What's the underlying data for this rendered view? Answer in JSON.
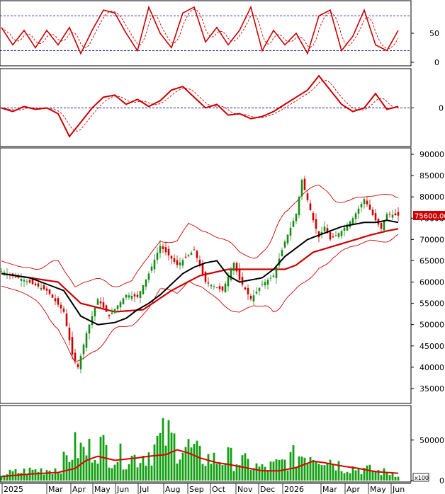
{
  "colors": {
    "background": "#ffffff",
    "frame": "#000000",
    "indicator_line": "#cc0000",
    "reference_dashed": "#1a1aa0",
    "bollinger": "#cc0000",
    "ma_long": "#cc0000",
    "ma_short": "#000000",
    "candle_up": "#1a8a1a",
    "candle_down": "#cc0000",
    "volume_bar": "#12a012",
    "volume_ma": "#dd0000",
    "price_tag_bg": "#cc0000",
    "price_tag_text": "#ffffff"
  },
  "x_axis": {
    "month_labels": [
      "2025",
      "Mar",
      "Apr",
      "May",
      "Jun",
      "Jul",
      "Aug",
      "Sep",
      "Oct",
      "Nov",
      "Dec",
      "2026",
      "Mar",
      "Apr",
      "May",
      "Jun"
    ]
  },
  "price_tag": "75600.00",
  "volume_unit": "x100",
  "chart_data": [
    {
      "type": "line",
      "panel": "oscillator",
      "ylim": [
        0,
        100
      ],
      "y_ticks": [
        "50",
        "0"
      ],
      "reference_lines": [
        80,
        20
      ],
      "x_index": [
        0,
        4,
        8,
        12,
        16,
        20,
        24,
        28,
        32,
        36,
        40,
        44,
        48,
        52,
        56,
        60,
        64,
        68,
        72,
        76,
        80,
        84,
        88,
        92,
        96,
        100,
        104,
        108,
        112,
        116,
        120,
        124,
        128,
        132,
        136,
        140
      ],
      "series": [
        {
          "values": [
            60,
            30,
            55,
            25,
            55,
            30,
            60,
            15,
            55,
            90,
            85,
            50,
            20,
            95,
            50,
            25,
            85,
            95,
            35,
            60,
            30,
            55,
            95,
            20,
            55,
            30,
            50,
            15,
            80,
            90,
            20,
            45,
            90,
            30,
            20,
            55
          ]
        }
      ]
    },
    {
      "type": "line",
      "panel": "momentum",
      "ylim": [
        -50,
        50
      ],
      "y_ticks": [
        "0"
      ],
      "reference_lines": [
        0
      ],
      "x_index": [
        0,
        4,
        8,
        12,
        16,
        20,
        24,
        28,
        32,
        36,
        40,
        44,
        48,
        52,
        56,
        60,
        64,
        68,
        72,
        76,
        80,
        84,
        88,
        92,
        96,
        100,
        104,
        108,
        112,
        116,
        120,
        124,
        128,
        132,
        136,
        140
      ],
      "series": [
        {
          "values": [
            0,
            -5,
            2,
            -2,
            0,
            -8,
            -40,
            -20,
            0,
            15,
            18,
            5,
            12,
            2,
            10,
            25,
            30,
            15,
            0,
            5,
            -10,
            -8,
            -15,
            -12,
            -5,
            5,
            15,
            25,
            45,
            25,
            5,
            -5,
            0,
            20,
            -2,
            2
          ]
        }
      ]
    },
    {
      "type": "candlestick",
      "panel": "price",
      "ylim": [
        32000,
        91000
      ],
      "y_ticks": [
        "90000",
        "85000",
        "80000",
        "75000",
        "70000",
        "65000",
        "60000",
        "55000",
        "50000",
        "45000",
        "40000",
        "35000"
      ],
      "close_anchors_index": [
        0,
        8,
        16,
        22,
        25,
        27,
        30,
        34,
        38,
        44,
        48,
        52,
        56,
        62,
        68,
        72,
        78,
        82,
        84,
        88,
        92,
        96,
        100,
        104,
        106,
        110,
        112,
        114,
        116,
        120,
        124,
        128,
        132,
        134,
        136,
        140
      ],
      "close_anchors": [
        62500,
        60500,
        58000,
        53000,
        43000,
        40000,
        48000,
        56000,
        52000,
        57000,
        56500,
        62000,
        68500,
        64000,
        67500,
        60000,
        58000,
        64500,
        60500,
        56000,
        59500,
        61500,
        69500,
        76000,
        84000,
        74500,
        70500,
        73000,
        70000,
        72000,
        75000,
        79500,
        74500,
        72500,
        76000,
        75600
      ],
      "bollinger_mid_index": [
        0,
        10,
        20,
        26,
        32,
        40,
        46,
        52,
        56,
        62,
        66,
        72,
        78,
        84,
        90,
        96,
        100,
        106,
        112,
        118,
        124,
        130,
        136,
        140
      ],
      "bollinger_mid": [
        62000,
        60000,
        57000,
        50000,
        52000,
        54000,
        55000,
        60000,
        64000,
        63500,
        67000,
        65000,
        62500,
        60000,
        60000,
        62000,
        66000,
        70000,
        73000,
        72500,
        74000,
        75000,
        75000,
        75500
      ],
      "ma_long_index": [
        0,
        20,
        28,
        40,
        50,
        60,
        70,
        80,
        90,
        100,
        104,
        110,
        120,
        130,
        136,
        140
      ],
      "ma_long": [
        62000,
        60000,
        55000,
        53000,
        53500,
        58000,
        61500,
        63000,
        63000,
        63000,
        64000,
        67000,
        69000,
        71000,
        72000,
        72500
      ],
      "ma_short_index": [
        0,
        10,
        22,
        28,
        34,
        40,
        44,
        48,
        52,
        56,
        60,
        64,
        68,
        72,
        76,
        80,
        84,
        88,
        92,
        96,
        100,
        104,
        108,
        112,
        116,
        120,
        124,
        128,
        132,
        136,
        140
      ],
      "ma_short": [
        62000,
        61000,
        58000,
        52000,
        50000,
        50500,
        51500,
        53500,
        55000,
        57000,
        59500,
        62000,
        63500,
        64500,
        65000,
        61500,
        60000,
        60500,
        61000,
        63000,
        66000,
        68000,
        70000,
        71000,
        72000,
        73000,
        73500,
        74000,
        74000,
        74500,
        74000
      ]
    },
    {
      "type": "bar",
      "panel": "volume",
      "ylim": [
        0,
        90000
      ],
      "y_ticks": [
        "50000",
        "0"
      ],
      "values_index": [
        0,
        10,
        20,
        26,
        30,
        34,
        40,
        48,
        52,
        58,
        62,
        66,
        70,
        76,
        80,
        86,
        92,
        98,
        104,
        110,
        114,
        120,
        126,
        132,
        136,
        140
      ],
      "values": [
        8000,
        12000,
        15000,
        40000,
        35000,
        45000,
        30000,
        28000,
        35000,
        55000,
        45000,
        40000,
        30000,
        25000,
        28000,
        22000,
        15000,
        20000,
        30000,
        35000,
        30000,
        18000,
        15000,
        12000,
        10000,
        8000
      ],
      "ma_index": [
        0,
        10,
        20,
        26,
        30,
        34,
        40,
        48,
        52,
        58,
        62,
        66,
        70,
        76,
        80,
        86,
        92,
        98,
        104,
        110,
        114,
        120,
        126,
        132,
        136,
        140
      ],
      "ma": [
        5000,
        8000,
        10000,
        15000,
        25000,
        30000,
        25000,
        28000,
        30000,
        32000,
        38000,
        34000,
        28000,
        22000,
        20000,
        16000,
        12000,
        12000,
        16000,
        24000,
        22000,
        18000,
        15000,
        11000,
        10000,
        9000
      ]
    }
  ]
}
